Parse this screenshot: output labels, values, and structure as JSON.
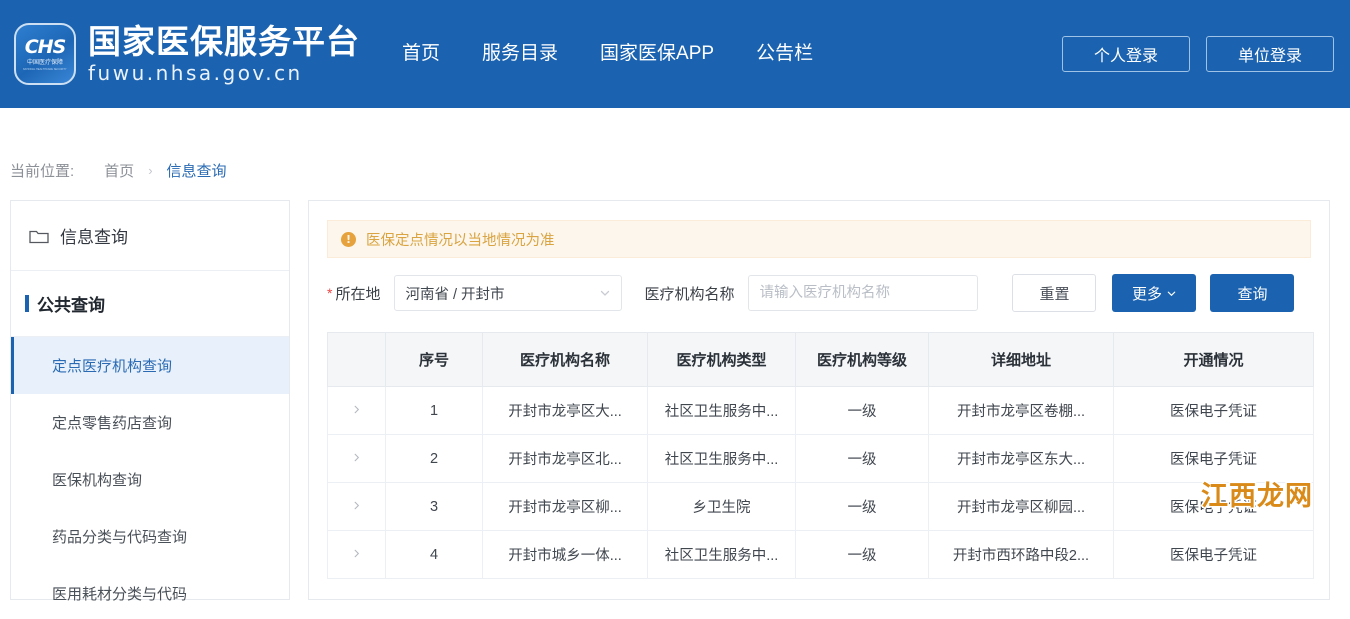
{
  "header": {
    "logo": {
      "mark": "CHS",
      "sub": "中国医疗保障",
      "sub_en": "NATIONAL HEALTHCARE SECURITY"
    },
    "brand_title": "国家医保服务平台",
    "brand_url": "fuwu.nhsa.gov.cn",
    "nav": [
      {
        "label": "首页"
      },
      {
        "label": "服务目录"
      },
      {
        "label": "国家医保APP"
      },
      {
        "label": "公告栏"
      }
    ],
    "auth": [
      {
        "label": "个人登录"
      },
      {
        "label": "单位登录"
      }
    ],
    "bg_color": "#1b63b0"
  },
  "breadcrumb": {
    "label": "当前位置:",
    "home": "首页",
    "separator": "›",
    "current": "信息查询"
  },
  "sidebar": {
    "head": {
      "label": "信息查询",
      "icon": "folder-icon"
    },
    "group": "公共查询",
    "items": [
      {
        "label": "定点医疗机构查询",
        "active": true
      },
      {
        "label": "定点零售药店查询",
        "active": false
      },
      {
        "label": "医保机构查询",
        "active": false
      },
      {
        "label": "药品分类与代码查询",
        "active": false
      },
      {
        "label": "医用耗材分类与代码",
        "active": false
      }
    ],
    "active_bg": "#e8f1fb",
    "active_color": "#2a6ab3"
  },
  "main": {
    "alert": {
      "text": "医保定点情况以当地情况为准",
      "icon": "exclamation-icon",
      "color": "#d9a441",
      "bg": "#fdf6ec"
    },
    "form": {
      "location_label": "所在地",
      "location_required": "*",
      "location_value": "河南省 / 开封市",
      "org_name_label": "医疗机构名称",
      "org_name_value": "",
      "org_name_placeholder": "请输入医疗机构名称"
    },
    "buttons": {
      "reset": "重置",
      "more": "更多",
      "more_chevron": "chevron-down-icon",
      "search": "查询"
    },
    "table": {
      "columns": [
        "",
        "序号",
        "医疗机构名称",
        "医疗机构类型",
        "医疗机构等级",
        "详细地址",
        "开通情况"
      ],
      "rows": [
        {
          "index": "1",
          "name": "开封市龙亭区大...",
          "type": "社区卫生服务中...",
          "level": "一级",
          "address": "开封市龙亭区卷棚...",
          "open": "医保电子凭证"
        },
        {
          "index": "2",
          "name": "开封市龙亭区北...",
          "type": "社区卫生服务中...",
          "level": "一级",
          "address": "开封市龙亭区东大...",
          "open": "医保电子凭证"
        },
        {
          "index": "3",
          "name": "开封市龙亭区柳...",
          "type": "乡卫生院",
          "level": "一级",
          "address": "开封市龙亭区柳园...",
          "open": "医保电子凭证"
        },
        {
          "index": "4",
          "name": "开封市城乡一体...",
          "type": "社区卫生服务中...",
          "level": "一级",
          "address": "开封市西环路中段2...",
          "open": "医保电子凭证"
        }
      ]
    }
  },
  "watermark": {
    "text": "江西龙网",
    "color": "#d98a18"
  }
}
